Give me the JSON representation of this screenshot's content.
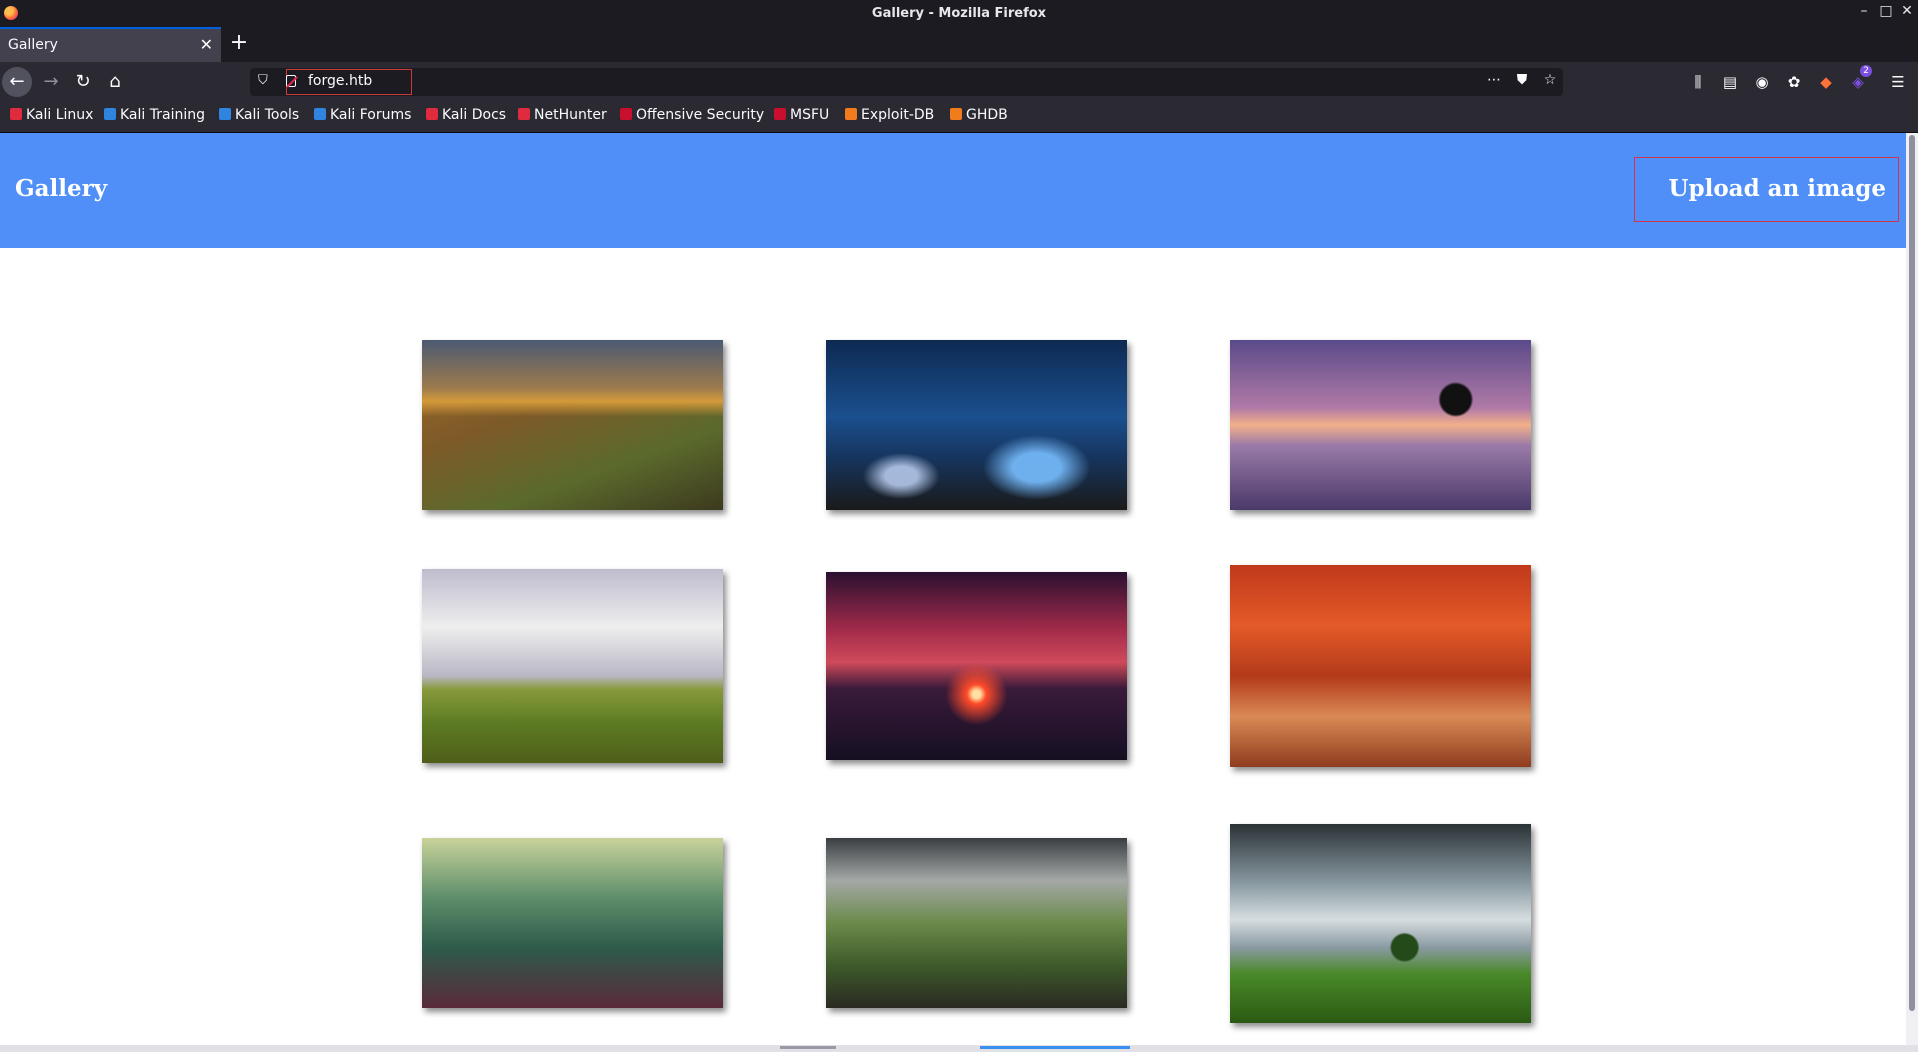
{
  "window": {
    "title": "Gallery - Mozilla Firefox"
  },
  "tab": {
    "title": "Gallery"
  },
  "url": {
    "value": "forge.htb"
  },
  "bookmarks": [
    {
      "label": "Kali Linux",
      "color": "#e02a3e"
    },
    {
      "label": "Kali Training",
      "color": "#2f84e0"
    },
    {
      "label": "Kali Tools",
      "color": "#2f84e0"
    },
    {
      "label": "Kali Forums",
      "color": "#2f84e0"
    },
    {
      "label": "Kali Docs",
      "color": "#e02a3e"
    },
    {
      "label": "NetHunter",
      "color": "#e02a3e"
    },
    {
      "label": "Offensive Security",
      "color": "#c8102e"
    },
    {
      "label": "MSFU",
      "color": "#c8102e"
    },
    {
      "label": "Exploit-DB",
      "color": "#f07c1e"
    },
    {
      "label": "GHDB",
      "color": "#f07c1e"
    }
  ],
  "toolbar": {
    "badge": "2"
  },
  "site": {
    "title": "Gallery",
    "upload_label": "Upload an image",
    "header_color": "#4f8ff7"
  },
  "gallery": {
    "images": [
      "mountain-landscape",
      "blue-butterflies",
      "lake-tree-sunset",
      "railway-track",
      "red-sky-tree",
      "autumn-forest-path",
      "misty-forest",
      "green-valley",
      "lone-tree-field"
    ]
  }
}
